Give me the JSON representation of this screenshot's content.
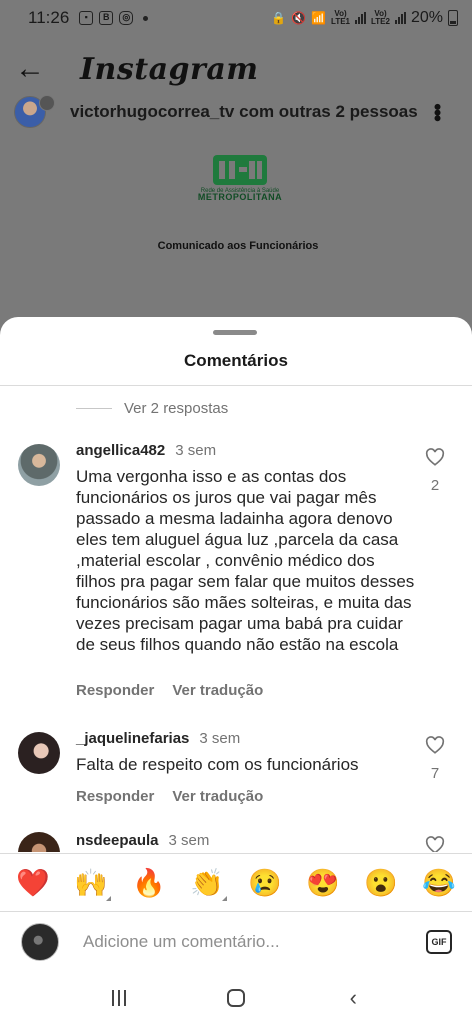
{
  "status_bar": {
    "time": "11:26",
    "battery": "20%",
    "network1": "VoLTE1",
    "network2": "VoLTE2",
    "notification_icons": [
      "photo-icon",
      "b-icon",
      "instagram-icon",
      "dot-icon"
    ],
    "status_icons": [
      "lock-icon",
      "mute-icon",
      "wifi-icon",
      "signal-icon",
      "signal-icon",
      "battery-icon"
    ]
  },
  "header": {
    "app_name": "Instagram",
    "back_icon": "arrow-left-icon"
  },
  "post": {
    "author": "victorhugocorrea_tv",
    "author_suffix": "com outras 2 pessoas",
    "brand_subtitle": "Rede de Assistência à Saúde",
    "brand_name": "METROPOLITANA",
    "caption": "Comunicado aos Funcionários"
  },
  "sheet": {
    "title": "Comentários",
    "view_replies": "Ver 2 respostas"
  },
  "comments": [
    {
      "user": "angellica482",
      "time": "3 sem",
      "text": "Uma vergonha isso e as contas dos funcionários  os juros que vai pagar mês passado a mesma  ladainha  agora denovo eles tem aluguel  água luz ,parcela da casa ,material escolar , convênio médico dos filhos pra pagar  sem falar que muitos desses funcionários  são mães solteiras, e muita das vezes  precisam pagar uma babá pra cuidar de seus filhos quando não estão na escola",
      "likes": "2",
      "reply_label": "Responder",
      "translate_label": "Ver tradução"
    },
    {
      "user": "_jaquelinefarias",
      "time": "3 sem",
      "text": "Falta de respeito com os funcionários",
      "likes": "7",
      "reply_label": "Responder",
      "translate_label": "Ver tradução"
    },
    {
      "user": "nsdeepaula",
      "time": "3 sem"
    }
  ],
  "emoji_bar": [
    "❤️",
    "🙌",
    "🔥",
    "👏",
    "😢",
    "😍",
    "😮",
    "😂"
  ],
  "composer": {
    "placeholder": "Adicione um comentário...",
    "gif_label": "GIF"
  }
}
